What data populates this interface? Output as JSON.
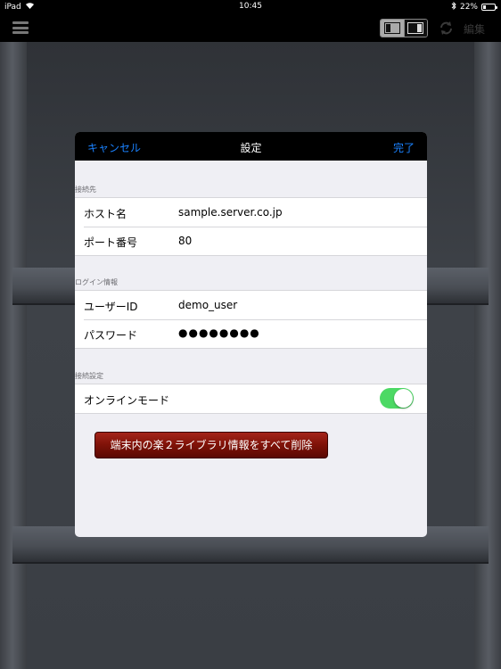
{
  "status_bar": {
    "device": "iPad",
    "time": "10:45",
    "battery_percent": "22%",
    "battery_level": 0.22
  },
  "toolbar": {
    "edit_label": "編集"
  },
  "modal": {
    "cancel_label": "キャンセル",
    "title": "設定",
    "done_label": "完了",
    "sections": {
      "connection": {
        "header": "接続先",
        "host_label": "ホスト名",
        "host_value": "sample.server.co.jp",
        "port_label": "ポート番号",
        "port_value": "80"
      },
      "login": {
        "header": "ログイン情報",
        "user_label": "ユーザーID",
        "user_value": "demo_user",
        "password_label": "パスワード",
        "password_value": "●●●●●●●●"
      },
      "settings": {
        "header": "接続設定",
        "online_label": "オンラインモード",
        "online_enabled": true
      }
    },
    "delete_button_label": "端末内の楽２ライブラリ情報をすべて削除"
  },
  "colors": {
    "accent": "#1a82ff",
    "switch_on": "#4cd964",
    "delete_button": "#7e1208"
  }
}
